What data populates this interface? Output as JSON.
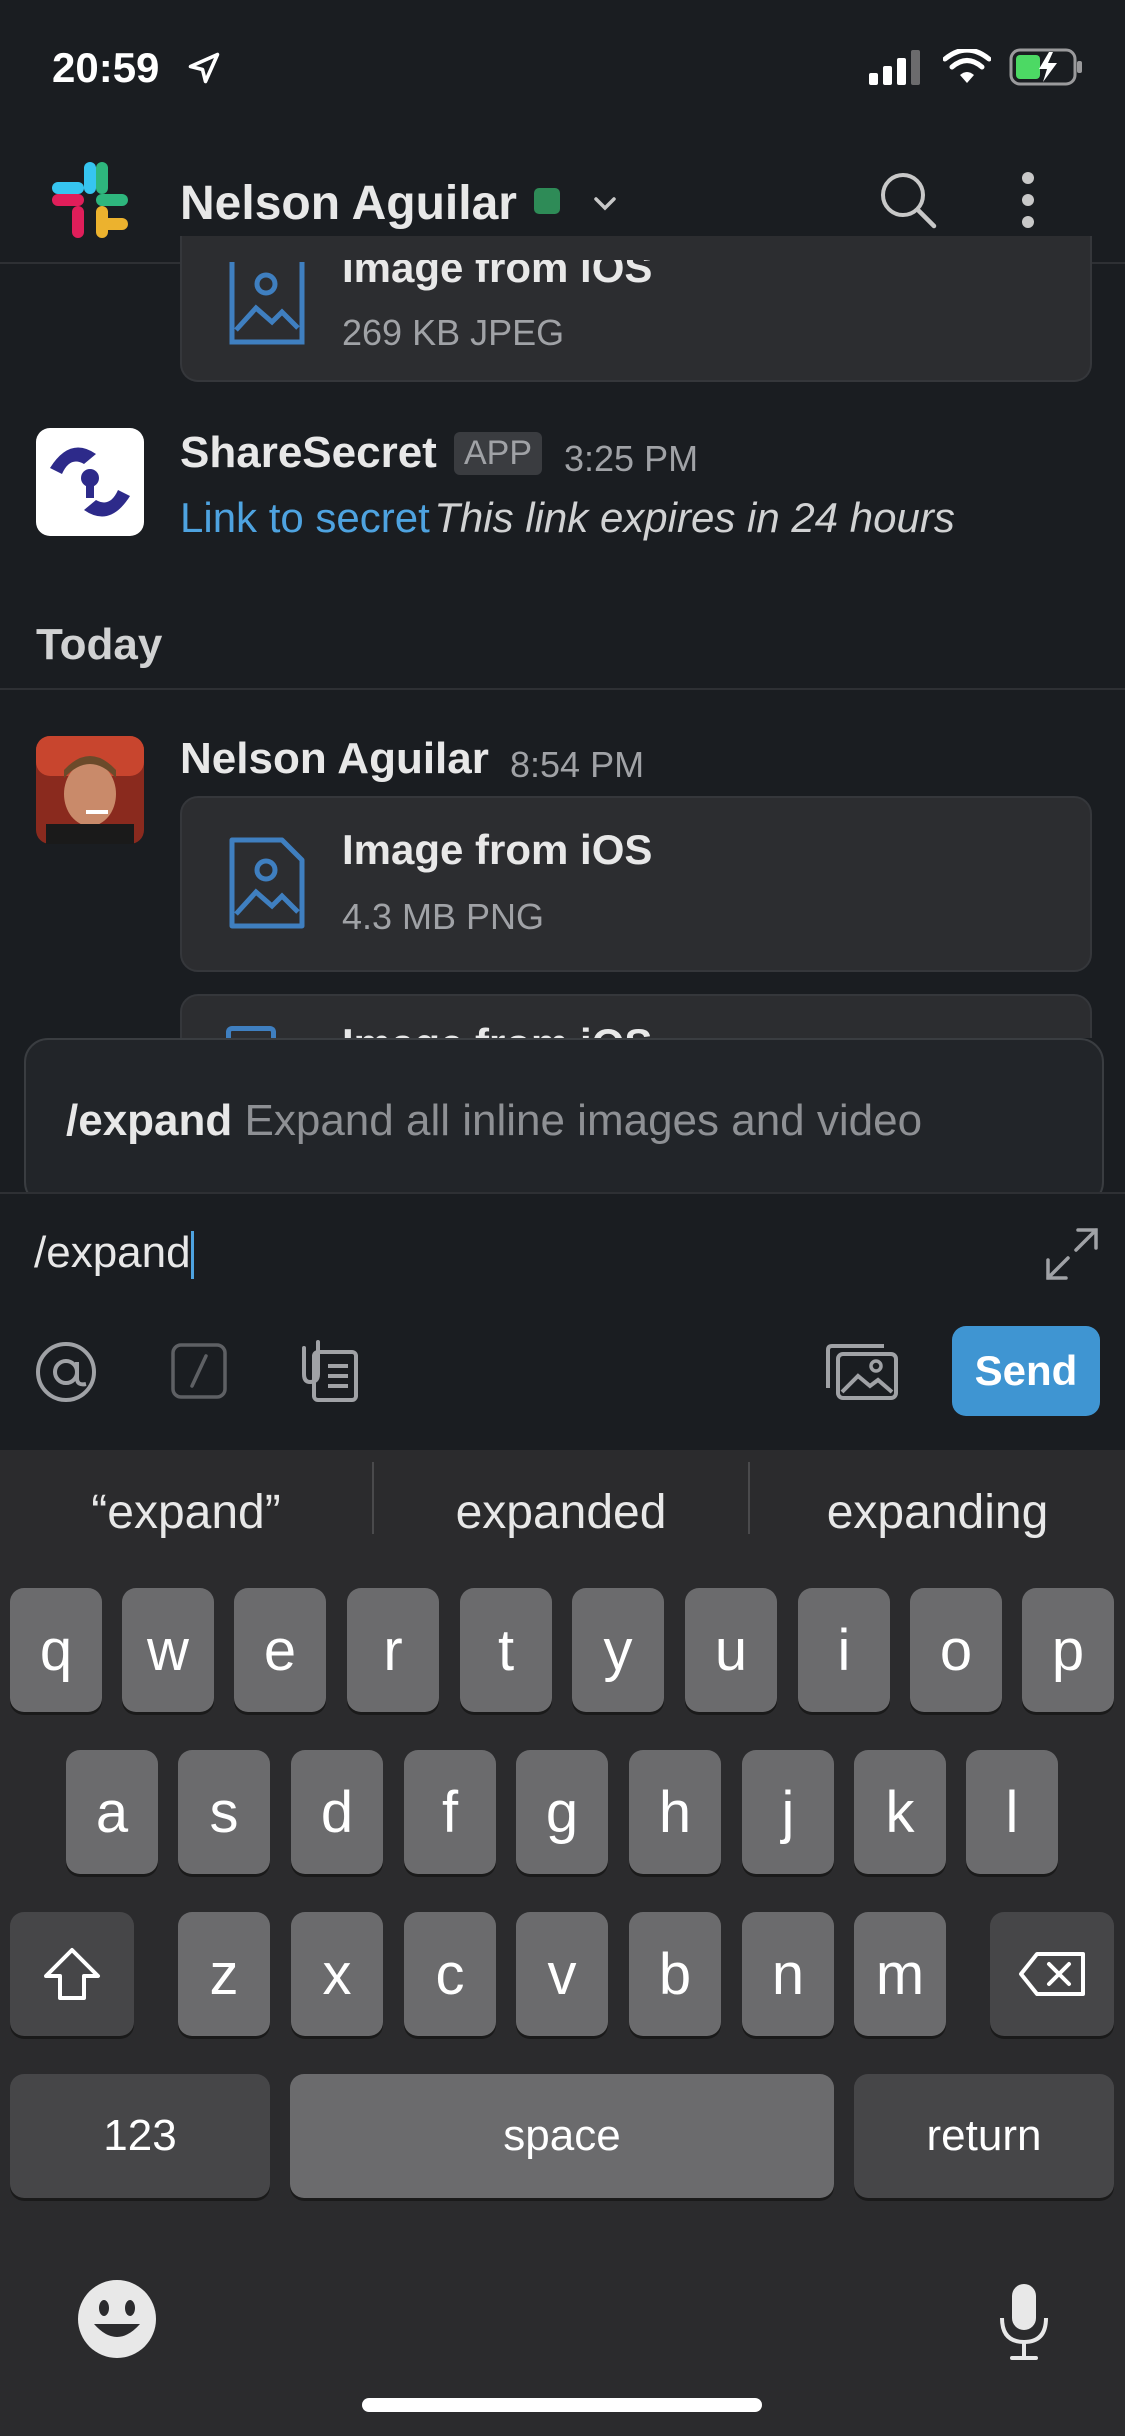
{
  "status": {
    "time": "20:59"
  },
  "header": {
    "title": "Nelson Aguilar"
  },
  "messages": {
    "file1": {
      "name": "Image from iOS",
      "meta": "269 KB JPEG"
    },
    "app_msg": {
      "sender": "ShareSecret",
      "badge": "APP",
      "time": "3:25 PM",
      "link_text": "Link to secret",
      "text": "This link expires in 24 hours"
    },
    "day_label": "Today",
    "user_msg": {
      "sender": "Nelson Aguilar",
      "time": "8:54 PM",
      "file": {
        "name": "Image from iOS",
        "meta": "4.3 MB PNG"
      }
    },
    "file3": {
      "name": "Image from iOS"
    }
  },
  "command_suggestion": {
    "command": "/expand",
    "description": "Expand all inline images and video"
  },
  "composer": {
    "value": "/expand",
    "send_label": "Send"
  },
  "keyboard": {
    "suggestions": [
      "“expand”",
      "expanded",
      "expanding"
    ],
    "row1": [
      "q",
      "w",
      "e",
      "r",
      "t",
      "y",
      "u",
      "i",
      "o",
      "p"
    ],
    "row2": [
      "a",
      "s",
      "d",
      "f",
      "g",
      "h",
      "j",
      "k",
      "l"
    ],
    "row3": [
      "z",
      "x",
      "c",
      "v",
      "b",
      "n",
      "m"
    ],
    "numbers_label": "123",
    "space_label": "space",
    "return_label": "return"
  },
  "colors": {
    "accent": "#3f95d2",
    "link": "#4ea3e0",
    "presence": "#2e8b57",
    "background": "#1a1d21"
  }
}
